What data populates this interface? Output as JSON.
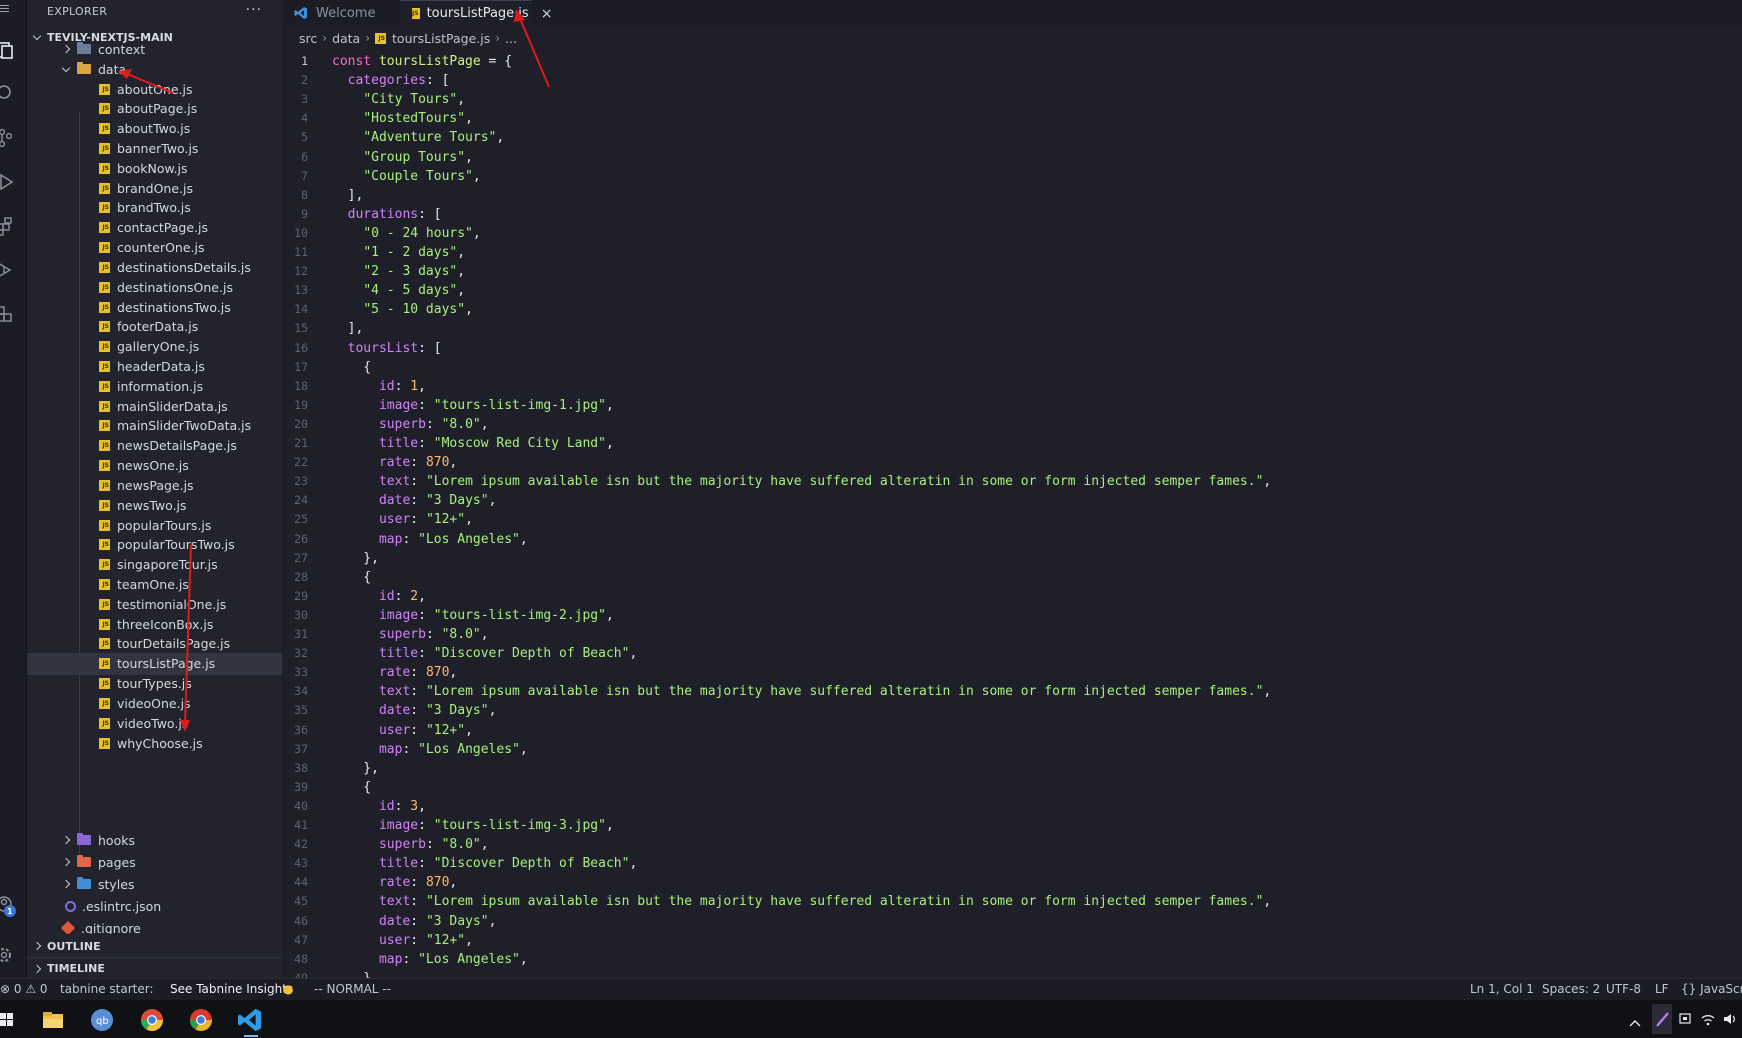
{
  "explorer": {
    "title": "EXPLORER",
    "more": "···",
    "project": "TEVILY-NEXTJS-MAIN",
    "context_folder": "context",
    "data_folder": "data",
    "files": [
      "aboutOne.js",
      "aboutPage.js",
      "aboutTwo.js",
      "bannerTwo.js",
      "bookNow.js",
      "brandOne.js",
      "brandTwo.js",
      "contactPage.js",
      "counterOne.js",
      "destinationsDetails.js",
      "destinationsOne.js",
      "destinationsTwo.js",
      "footerData.js",
      "galleryOne.js",
      "headerData.js",
      "information.js",
      "mainSliderData.js",
      "mainSliderTwoData.js",
      "newsDetailsPage.js",
      "newsOne.js",
      "newsPage.js",
      "newsTwo.js",
      "popularTours.js",
      "popularToursTwo.js",
      "singaporeTour.js",
      "teamOne.js",
      "testimonialOne.js",
      "threeIconBox.js",
      "tourDetailsPage.js",
      "toursListPage.js",
      "tourTypes.js",
      "videoOne.js",
      "videoTwo.js",
      "whyChoose.js"
    ],
    "selected_index": 29,
    "folders": [
      "hooks",
      "pages",
      "styles"
    ],
    "root_files": [
      ".eslintrc.json",
      ".gitignore"
    ],
    "outline": "OUTLINE",
    "timeline": "TIMELINE"
  },
  "tabs": [
    {
      "label": "Welcome",
      "active": false
    },
    {
      "label": "toursListPage.js",
      "active": true,
      "close": "×"
    }
  ],
  "breadcrumb": [
    "src",
    "data",
    "toursListPage.js",
    "..."
  ],
  "code_lines": [
    [
      [
        "k",
        "const "
      ],
      [
        "v",
        "toursListPage"
      ],
      [
        "t",
        " = {"
      ]
    ],
    [
      [
        "t",
        "  "
      ],
      [
        "p",
        "categories"
      ],
      [
        "t",
        ": ["
      ]
    ],
    [
      [
        "t",
        "    "
      ],
      [
        "s",
        "\"City Tours\""
      ],
      [
        "t",
        ","
      ]
    ],
    [
      [
        "t",
        "    "
      ],
      [
        "s",
        "\"HostedTours\""
      ],
      [
        "t",
        ","
      ]
    ],
    [
      [
        "t",
        "    "
      ],
      [
        "s",
        "\"Adventure Tours\""
      ],
      [
        "t",
        ","
      ]
    ],
    [
      [
        "t",
        "    "
      ],
      [
        "s",
        "\"Group Tours\""
      ],
      [
        "t",
        ","
      ]
    ],
    [
      [
        "t",
        "    "
      ],
      [
        "s",
        "\"Couple Tours\""
      ],
      [
        "t",
        ","
      ]
    ],
    [
      [
        "t",
        "  ],"
      ]
    ],
    [
      [
        "t",
        "  "
      ],
      [
        "p",
        "durations"
      ],
      [
        "t",
        ": ["
      ]
    ],
    [
      [
        "t",
        "    "
      ],
      [
        "s",
        "\"0 - 24 hours\""
      ],
      [
        "t",
        ","
      ]
    ],
    [
      [
        "t",
        "    "
      ],
      [
        "s",
        "\"1 - 2 days\""
      ],
      [
        "t",
        ","
      ]
    ],
    [
      [
        "t",
        "    "
      ],
      [
        "s",
        "\"2 - 3 days\""
      ],
      [
        "t",
        ","
      ]
    ],
    [
      [
        "t",
        "    "
      ],
      [
        "s",
        "\"4 - 5 days\""
      ],
      [
        "t",
        ","
      ]
    ],
    [
      [
        "t",
        "    "
      ],
      [
        "s",
        "\"5 - 10 days\""
      ],
      [
        "t",
        ","
      ]
    ],
    [
      [
        "t",
        "  ],"
      ]
    ],
    [
      [
        "t",
        "  "
      ],
      [
        "p",
        "toursList"
      ],
      [
        "t",
        ": ["
      ]
    ],
    [
      [
        "t",
        "    {"
      ]
    ],
    [
      [
        "t",
        "      "
      ],
      [
        "p",
        "id"
      ],
      [
        "t",
        ": "
      ],
      [
        "n",
        "1"
      ],
      [
        "t",
        ","
      ]
    ],
    [
      [
        "t",
        "      "
      ],
      [
        "p",
        "image"
      ],
      [
        "t",
        ": "
      ],
      [
        "s",
        "\"tours-list-img-1.jpg\""
      ],
      [
        "t",
        ","
      ]
    ],
    [
      [
        "t",
        "      "
      ],
      [
        "p",
        "superb"
      ],
      [
        "t",
        ": "
      ],
      [
        "s",
        "\"8.0\""
      ],
      [
        "t",
        ","
      ]
    ],
    [
      [
        "t",
        "      "
      ],
      [
        "p",
        "title"
      ],
      [
        "t",
        ": "
      ],
      [
        "s",
        "\"Moscow Red City Land\""
      ],
      [
        "t",
        ","
      ]
    ],
    [
      [
        "t",
        "      "
      ],
      [
        "p",
        "rate"
      ],
      [
        "t",
        ": "
      ],
      [
        "n",
        "870"
      ],
      [
        "t",
        ","
      ]
    ],
    [
      [
        "t",
        "      "
      ],
      [
        "p",
        "text"
      ],
      [
        "t",
        ": "
      ],
      [
        "s",
        "\"Lorem ipsum available isn but the majority have suffered alteratin in some or form injected semper fames.\""
      ],
      [
        "t",
        ","
      ]
    ],
    [
      [
        "t",
        "      "
      ],
      [
        "p",
        "date"
      ],
      [
        "t",
        ": "
      ],
      [
        "s",
        "\"3 Days\""
      ],
      [
        "t",
        ","
      ]
    ],
    [
      [
        "t",
        "      "
      ],
      [
        "p",
        "user"
      ],
      [
        "t",
        ": "
      ],
      [
        "s",
        "\"12+\""
      ],
      [
        "t",
        ","
      ]
    ],
    [
      [
        "t",
        "      "
      ],
      [
        "p",
        "map"
      ],
      [
        "t",
        ": "
      ],
      [
        "s",
        "\"Los Angeles\""
      ],
      [
        "t",
        ","
      ]
    ],
    [
      [
        "t",
        "    },"
      ]
    ],
    [
      [
        "t",
        "    {"
      ]
    ],
    [
      [
        "t",
        "      "
      ],
      [
        "p",
        "id"
      ],
      [
        "t",
        ": "
      ],
      [
        "n",
        "2"
      ],
      [
        "t",
        ","
      ]
    ],
    [
      [
        "t",
        "      "
      ],
      [
        "p",
        "image"
      ],
      [
        "t",
        ": "
      ],
      [
        "s",
        "\"tours-list-img-2.jpg\""
      ],
      [
        "t",
        ","
      ]
    ],
    [
      [
        "t",
        "      "
      ],
      [
        "p",
        "superb"
      ],
      [
        "t",
        ": "
      ],
      [
        "s",
        "\"8.0\""
      ],
      [
        "t",
        ","
      ]
    ],
    [
      [
        "t",
        "      "
      ],
      [
        "p",
        "title"
      ],
      [
        "t",
        ": "
      ],
      [
        "s",
        "\"Discover Depth of Beach\""
      ],
      [
        "t",
        ","
      ]
    ],
    [
      [
        "t",
        "      "
      ],
      [
        "p",
        "rate"
      ],
      [
        "t",
        ": "
      ],
      [
        "n",
        "870"
      ],
      [
        "t",
        ","
      ]
    ],
    [
      [
        "t",
        "      "
      ],
      [
        "p",
        "text"
      ],
      [
        "t",
        ": "
      ],
      [
        "s",
        "\"Lorem ipsum available isn but the majority have suffered alteratin in some or form injected semper fames.\""
      ],
      [
        "t",
        ","
      ]
    ],
    [
      [
        "t",
        "      "
      ],
      [
        "p",
        "date"
      ],
      [
        "t",
        ": "
      ],
      [
        "s",
        "\"3 Days\""
      ],
      [
        "t",
        ","
      ]
    ],
    [
      [
        "t",
        "      "
      ],
      [
        "p",
        "user"
      ],
      [
        "t",
        ": "
      ],
      [
        "s",
        "\"12+\""
      ],
      [
        "t",
        ","
      ]
    ],
    [
      [
        "t",
        "      "
      ],
      [
        "p",
        "map"
      ],
      [
        "t",
        ": "
      ],
      [
        "s",
        "\"Los Angeles\""
      ],
      [
        "t",
        ","
      ]
    ],
    [
      [
        "t",
        "    },"
      ]
    ],
    [
      [
        "t",
        "    {"
      ]
    ],
    [
      [
        "t",
        "      "
      ],
      [
        "p",
        "id"
      ],
      [
        "t",
        ": "
      ],
      [
        "n",
        "3"
      ],
      [
        "t",
        ","
      ]
    ],
    [
      [
        "t",
        "      "
      ],
      [
        "p",
        "image"
      ],
      [
        "t",
        ": "
      ],
      [
        "s",
        "\"tours-list-img-3.jpg\""
      ],
      [
        "t",
        ","
      ]
    ],
    [
      [
        "t",
        "      "
      ],
      [
        "p",
        "superb"
      ],
      [
        "t",
        ": "
      ],
      [
        "s",
        "\"8.0\""
      ],
      [
        "t",
        ","
      ]
    ],
    [
      [
        "t",
        "      "
      ],
      [
        "p",
        "title"
      ],
      [
        "t",
        ": "
      ],
      [
        "s",
        "\"Discover Depth of Beach\""
      ],
      [
        "t",
        ","
      ]
    ],
    [
      [
        "t",
        "      "
      ],
      [
        "p",
        "rate"
      ],
      [
        "t",
        ": "
      ],
      [
        "n",
        "870"
      ],
      [
        "t",
        ","
      ]
    ],
    [
      [
        "t",
        "      "
      ],
      [
        "p",
        "text"
      ],
      [
        "t",
        ": "
      ],
      [
        "s",
        "\"Lorem ipsum available isn but the majority have suffered alteratin in some or form injected semper fames.\""
      ],
      [
        "t",
        ","
      ]
    ],
    [
      [
        "t",
        "      "
      ],
      [
        "p",
        "date"
      ],
      [
        "t",
        ": "
      ],
      [
        "s",
        "\"3 Days\""
      ],
      [
        "t",
        ","
      ]
    ],
    [
      [
        "t",
        "      "
      ],
      [
        "p",
        "user"
      ],
      [
        "t",
        ": "
      ],
      [
        "s",
        "\"12+\""
      ],
      [
        "t",
        ","
      ]
    ],
    [
      [
        "t",
        "      "
      ],
      [
        "p",
        "map"
      ],
      [
        "t",
        ": "
      ],
      [
        "s",
        "\"Los Angeles\""
      ],
      [
        "t",
        ","
      ]
    ],
    [
      [
        "t",
        "    },"
      ]
    ]
  ],
  "status": {
    "problems": "⊗ 0 ⚠ 0",
    "tabnine": "tabnine starter:",
    "tabnine_link": "See Tabnine Insights",
    "mode": "-- NORMAL --",
    "position": "Ln 1, Col 1",
    "spaces": "Spaces: 2",
    "encoding": "UTF-8",
    "eol": "LF",
    "language": "{} JavaScri"
  },
  "accounts_badge": "1",
  "colors": {
    "js": "#e8c02a",
    "folder_data": "#d9a441",
    "folder_hooks": "#8a66d6",
    "folder_pages": "#e0664a",
    "folder_styles": "#3f8fd6",
    "annotation": "#e01b1b"
  },
  "taskbar_icons": [
    "windows-start-icon",
    "file-explorer-icon",
    "qbittorrent-icon",
    "chrome-icon",
    "chrome-canary-icon",
    "vscode-icon"
  ]
}
